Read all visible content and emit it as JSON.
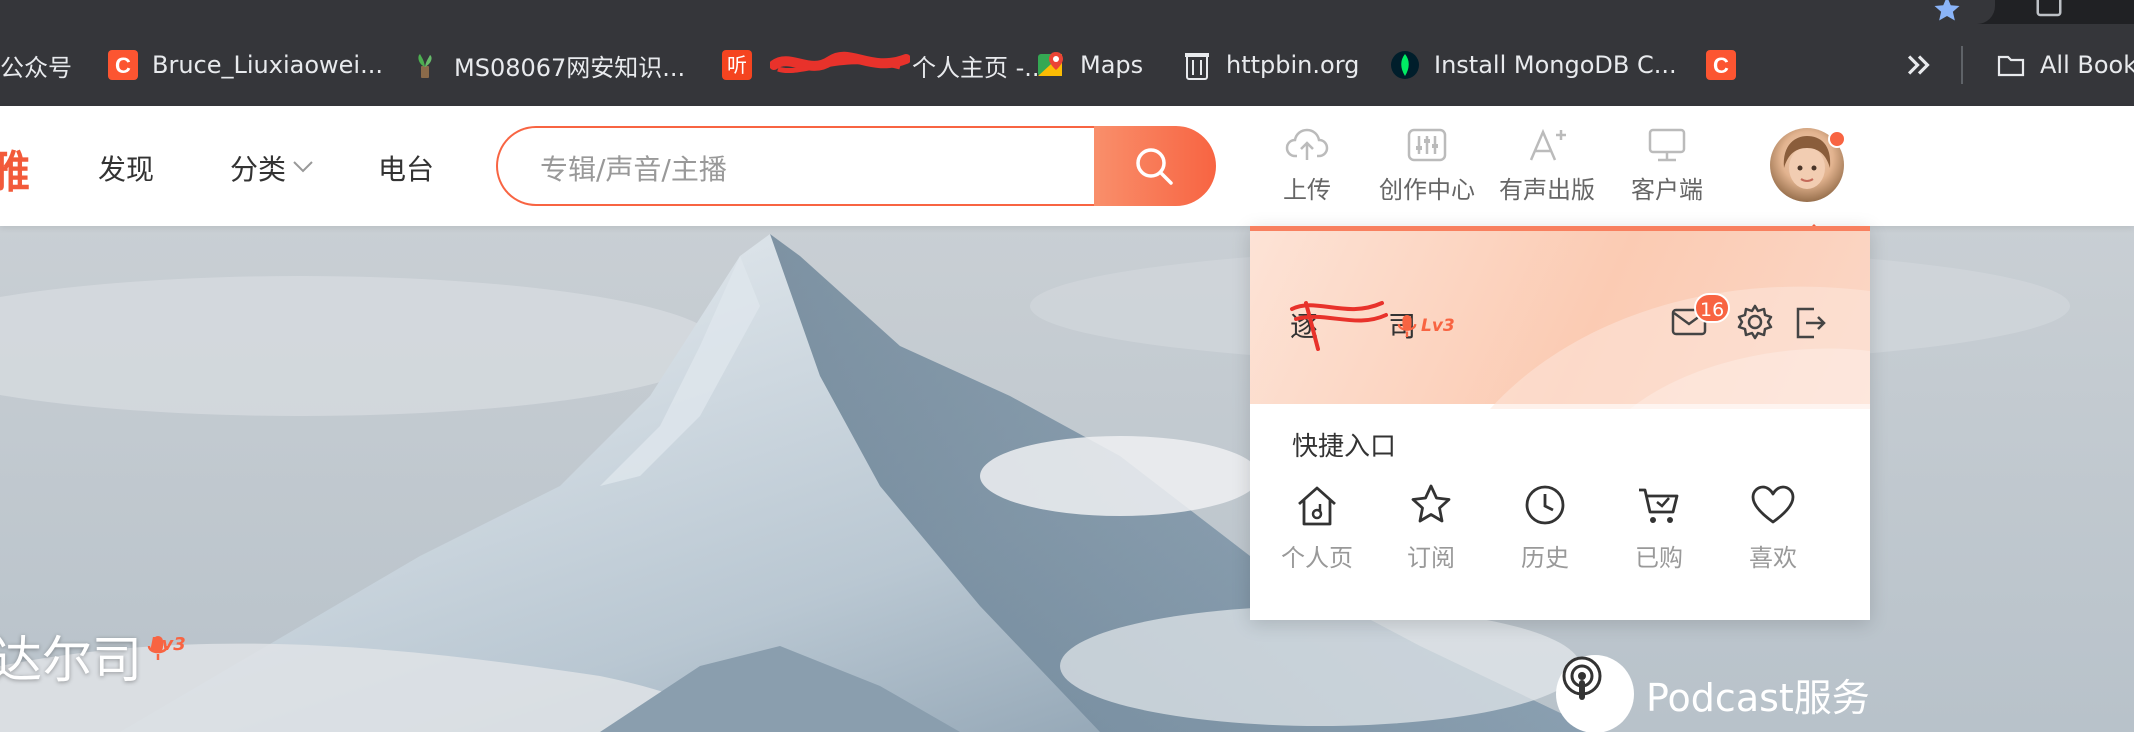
{
  "browser": {
    "url_fragment": "",
    "bookmarks": [
      {
        "label": "公众号",
        "icon": "none"
      },
      {
        "label": "Bruce_Liuxiaowei...",
        "icon": "csdn-icon"
      },
      {
        "label": "MS08067网安知识...",
        "icon": "plant-icon"
      },
      {
        "label": "听",
        "icon": "ting-icon"
      },
      {
        "label": "个人主页 -...",
        "icon": "none"
      },
      {
        "label": "Maps",
        "icon": "maps-icon"
      },
      {
        "label": "httpbin.org",
        "icon": "httpbin-icon"
      },
      {
        "label": "Install MongoDB C...",
        "icon": "mongodb-icon"
      },
      {
        "label": "",
        "icon": "csdn-icon"
      }
    ],
    "all_bookmarks_label": "All Book"
  },
  "header": {
    "logo_fragment": "雅",
    "nav": {
      "discover": "发现",
      "category": "分类",
      "radio": "电台"
    },
    "search": {
      "placeholder": "专辑/声音/主播"
    },
    "tools": {
      "upload": "上传",
      "creator": "创作中心",
      "publish": "有声出版",
      "client": "客户端"
    }
  },
  "hero": {
    "name": "达尔司",
    "level": "Lv3",
    "subtitle": "",
    "podcast_label": "Podcast服务"
  },
  "dropdown": {
    "username": "逐",
    "username_tail": "司",
    "level": "Lv3",
    "message_count": "16",
    "quick_title": "快捷入口",
    "quick_items": {
      "home": "个人页",
      "subscribe": "订阅",
      "history": "历史",
      "purchased": "已购",
      "favorites": "喜欢"
    }
  },
  "colors": {
    "brand": "#f86442",
    "bookmark_bar": "#35363a",
    "dropdown_header": "#fbcbb3"
  }
}
